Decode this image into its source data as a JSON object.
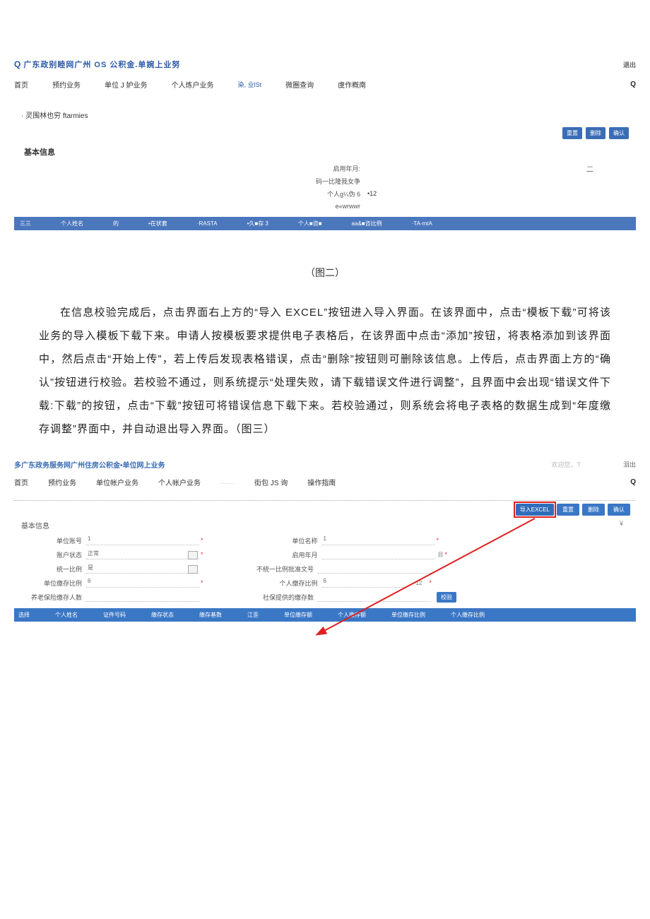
{
  "fig1": {
    "title": "广东政别睦网广州 OS 公积金.单婉上业努",
    "exit": "退出",
    "nav": [
      "首页",
      "预约业务",
      "单位 J 妒业务",
      "个人炼户业务"
    ],
    "nav_accent": "染, 业lSt",
    "nav_tail": [
      "微圏查询",
      "虞作概南"
    ],
    "searchQ": "Q",
    "bullet": "· 灵围林也穷 ftarmies",
    "btns": [
      "重置",
      "删除",
      "确认"
    ],
    "section": "基本信息",
    "rows": [
      {
        "label": "启用年月:",
        "value": "",
        "rt": "二"
      },
      {
        "label": "码一比隆我女争",
        "value": "",
        "rt": ""
      },
      {
        "label": "个人g¼伪 6",
        "value": "•12",
        "rt": ""
      },
      {
        "label": "e«wrwwr",
        "value": "",
        "rt": ""
      }
    ],
    "bluebar": [
      "三三",
      "个人姓名",
      "的",
      "•在状套",
      "·RASTA",
      "•久■存 3",
      "个人■咨■",
      "aa&■咨比例",
      "·TA-mtA"
    ]
  },
  "caption2": "（图二）",
  "body": "在信息校验完成后，点击界面右上方的“导入 EXCEL”按钮进入导入界面。在该界面中，点击“模板下载”可将该业务的导入模板下载下来。申请人按模板要求提供电子表格后，在该界面中点击“添加”按钮，将表格添加到该界面中，然后点击“开始上传”，若上传后发现表格错误，点击“删除”按钮则可删除该信息。上传后，点击界面上方的“确认”按钮进行校验。若校验不通过，则系统提示“处理失败，请下载错误文件进行调整”，且界面中会出现“错误文件下载:下载”的按钮，点击“下载”按钮可将错误信息下载下来。若校验通过，则系统会将电子表格的数据生成到“年度缴存调整”界面中，并自动退出导入界面。（图三）",
  "fig3": {
    "title_pref": "多",
    "title": "广东政务服务网广州住房公积金•单位网上业务",
    "welcome": "欢迎您，T",
    "exit": "泪出",
    "nav": [
      "首页",
      "预约业务",
      "单位帐户业务",
      "个人帐户业务"
    ],
    "nav_dots": "……",
    "nav_tail": [
      "街包 JS 询",
      "操作指南"
    ],
    "searchQ": "Q",
    "btns": {
      "excel": "导入EXCEL",
      "reset": "重置",
      "delete": "删除",
      "confirm": "确认"
    },
    "section": "基本信息",
    "yen": "¥",
    "form": {
      "r1": {
        "l1": "单位账号",
        "v1": "1",
        "l2": "单位名称",
        "v2": "1"
      },
      "r2": {
        "l1": "账户状态",
        "v1": "正常",
        "l2": "启用年月",
        "v2": "",
        "rt": "目"
      },
      "r3": {
        "l1": "统一比例",
        "v1": "是",
        "l2": "不统一比例批准文号",
        "v2": ""
      },
      "r4": {
        "l1": "单位缴存比例",
        "v1": "6",
        "l2": "个人缴存比例",
        "v2": "6",
        "mid": "-  12"
      },
      "r5": {
        "l1": "养老保险缴存人数",
        "v1": "",
        "l2": "社保提供的缴存数",
        "v2": "",
        "btn": "校验"
      }
    },
    "tbar": [
      "选择",
      "个人姓名",
      "证件号码",
      "缴存状态",
      "缴存基数",
      "江歪",
      "单位缴存额",
      "个人缴存额",
      "单位缴存比例",
      "个人缴存比例"
    ]
  }
}
